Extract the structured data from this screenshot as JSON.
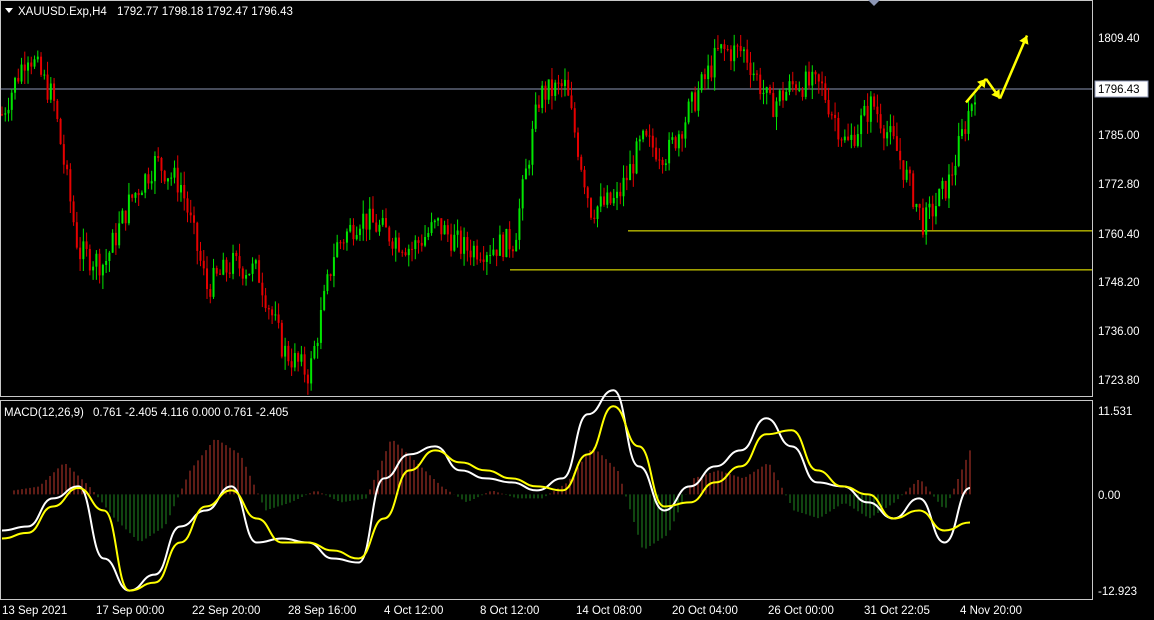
{
  "symbol_header": {
    "symbol": "XAUUSD.Exp,H4",
    "ohlc": "1792.77 1798.18 1792.47 1796.43"
  },
  "macd_header": {
    "name": "MACD(12,26,9)",
    "values": "0.761 -2.405 4.116 0.000 0.761 -2.405"
  },
  "colors": {
    "background": "#000000",
    "frame": "#c8c8c8",
    "bull_candle": "#00e600",
    "bear_candle": "#e60000",
    "level_line": "#ffff00",
    "bid_line": "#8c96b4",
    "macd_line": "#ffffff",
    "signal_line": "#ffff00",
    "hist_positive": "#c0392b",
    "hist_negative": "#1f8a1f",
    "arrow": "#ffff00"
  },
  "price_axis": {
    "ticks": [
      "1809.40",
      "1796.43",
      "1785.00",
      "1772.80",
      "1760.40",
      "1748.20",
      "1736.00",
      "1723.80"
    ],
    "current_price": "1796.43"
  },
  "macd_axis": {
    "ticks": [
      "11.531",
      "0.00",
      "-12.923"
    ]
  },
  "time_axis": {
    "ticks": [
      "13 Sep 2021",
      "17 Sep 00:00",
      "22 Sep 20:00",
      "28 Sep 16:00",
      "4 Oct 12:00",
      "8 Oct 12:00",
      "14 Oct 08:00",
      "20 Oct 04:00",
      "26 Oct 00:00",
      "31 Oct 22:05",
      "4 Nov 20:00"
    ]
  },
  "chart_data": [
    {
      "type": "candlestick",
      "timeframe": "H4",
      "symbol": "XAUUSD.Exp",
      "ylim": [
        1718.5,
        1818.5
      ],
      "x_range": [
        "13 Sep 2021",
        "4 Nov 20:00"
      ],
      "current_price": 1796.43,
      "horizontal_levels": [
        1760.4,
        1750.5
      ],
      "price_path": [
        [
          "13 Sep 2021",
          1790.0
        ],
        [
          "14 Sep",
          1806.0
        ],
        [
          "15 Sep",
          1794.0
        ],
        [
          "16 Sep",
          1755.0
        ],
        [
          "17 Sep 00:00",
          1752.0
        ],
        [
          "18 Sep",
          1768.0
        ],
        [
          "20 Sep",
          1778.0
        ],
        [
          "21 Sep",
          1772.0
        ],
        [
          "22 Sep 20:00",
          1746.0
        ],
        [
          "24 Sep",
          1752.0
        ],
        [
          "27 Sep",
          1750.0
        ],
        [
          "28 Sep",
          1730.0
        ],
        [
          "28 Sep 16:00",
          1724.0
        ],
        [
          "30 Sep",
          1756.0
        ],
        [
          "1 Oct",
          1764.0
        ],
        [
          "4 Oct 12:00",
          1760.0
        ],
        [
          "5 Oct",
          1756.0
        ],
        [
          "6 Oct",
          1762.0
        ],
        [
          "7 Oct",
          1756.0
        ],
        [
          "8 Oct 12:00",
          1756.0
        ],
        [
          "11 Oct",
          1758.0
        ],
        [
          "13 Oct",
          1795.0
        ],
        [
          "14 Oct 08:00",
          1797.0
        ],
        [
          "15 Oct",
          1766.0
        ],
        [
          "18 Oct",
          1768.0
        ],
        [
          "19 Oct",
          1783.0
        ],
        [
          "20 Oct 04:00",
          1780.0
        ],
        [
          "21 Oct",
          1793.0
        ],
        [
          "22 Oct",
          1806.0
        ],
        [
          "25 Oct",
          1806.0
        ],
        [
          "26 Oct 00:00",
          1792.0
        ],
        [
          "27 Oct",
          1798.0
        ],
        [
          "28 Oct",
          1797.0
        ],
        [
          "29 Oct",
          1782.0
        ],
        [
          "31 Oct 22:05",
          1793.0
        ],
        [
          "2 Nov",
          1780.0
        ],
        [
          "3 Nov",
          1762.0
        ],
        [
          "4 Nov",
          1773.0
        ],
        [
          "4 Nov 20:00",
          1796.43
        ]
      ],
      "forecast_arrows": [
        {
          "from": 1793.0,
          "to": 1799.0
        },
        {
          "from": 1799.0,
          "to": 1794.0
        },
        {
          "from": 1794.0,
          "to": 1810.0
        }
      ]
    },
    {
      "type": "line",
      "indicator": "MACD(12,26,9)",
      "ylim": [
        -12.923,
        11.531
      ],
      "series": [
        {
          "name": "MACD",
          "values": [
            -4.5,
            -4.0,
            -0.5,
            1.0,
            -8.0,
            -12.0,
            -10.0,
            -4.0,
            -2.0,
            1.0,
            -6.0,
            -5.5,
            -6.0,
            -8.0,
            -8.5,
            2.0,
            5.0,
            6.0,
            3.0,
            2.0,
            1.5,
            0.5,
            2.0,
            10.0,
            13.0,
            3.5,
            -2.0,
            1.0,
            3.5,
            5.5,
            9.5,
            6.0,
            1.5,
            1.0,
            -1.0,
            -3.0,
            -0.5,
            -6.0,
            0.8
          ]
        },
        {
          "name": "Signal",
          "values": [
            -5.5,
            -4.8,
            -1.5,
            0.8,
            -2.0,
            -12.0,
            -11.0,
            -6.0,
            -1.5,
            0.5,
            -3.0,
            -6.0,
            -6.0,
            -7.0,
            -8.0,
            -3.0,
            3.0,
            5.5,
            4.0,
            3.0,
            2.0,
            1.0,
            0.5,
            5.0,
            11.0,
            6.0,
            -1.5,
            -1.0,
            1.5,
            3.5,
            7.5,
            8.0,
            3.0,
            1.0,
            0.0,
            -3.0,
            -2.0,
            -4.5,
            -3.5
          ]
        }
      ],
      "histogram": [
        0.5,
        1.0,
        4.0,
        1.0,
        -3.0,
        -6.0,
        -4.0,
        3.0,
        7.0,
        5.0,
        -2.0,
        -1.0,
        0.5,
        -1.0,
        -0.5,
        7.0,
        4.0,
        1.0,
        -1.0,
        0.5,
        -0.5,
        -0.5,
        1.5,
        6.0,
        3.0,
        -7.0,
        -5.0,
        2.0,
        3.0,
        2.0,
        4.0,
        -2.0,
        -3.0,
        -1.0,
        -3.0,
        -1.0,
        2.0,
        -2.0,
        5.5
      ]
    }
  ]
}
